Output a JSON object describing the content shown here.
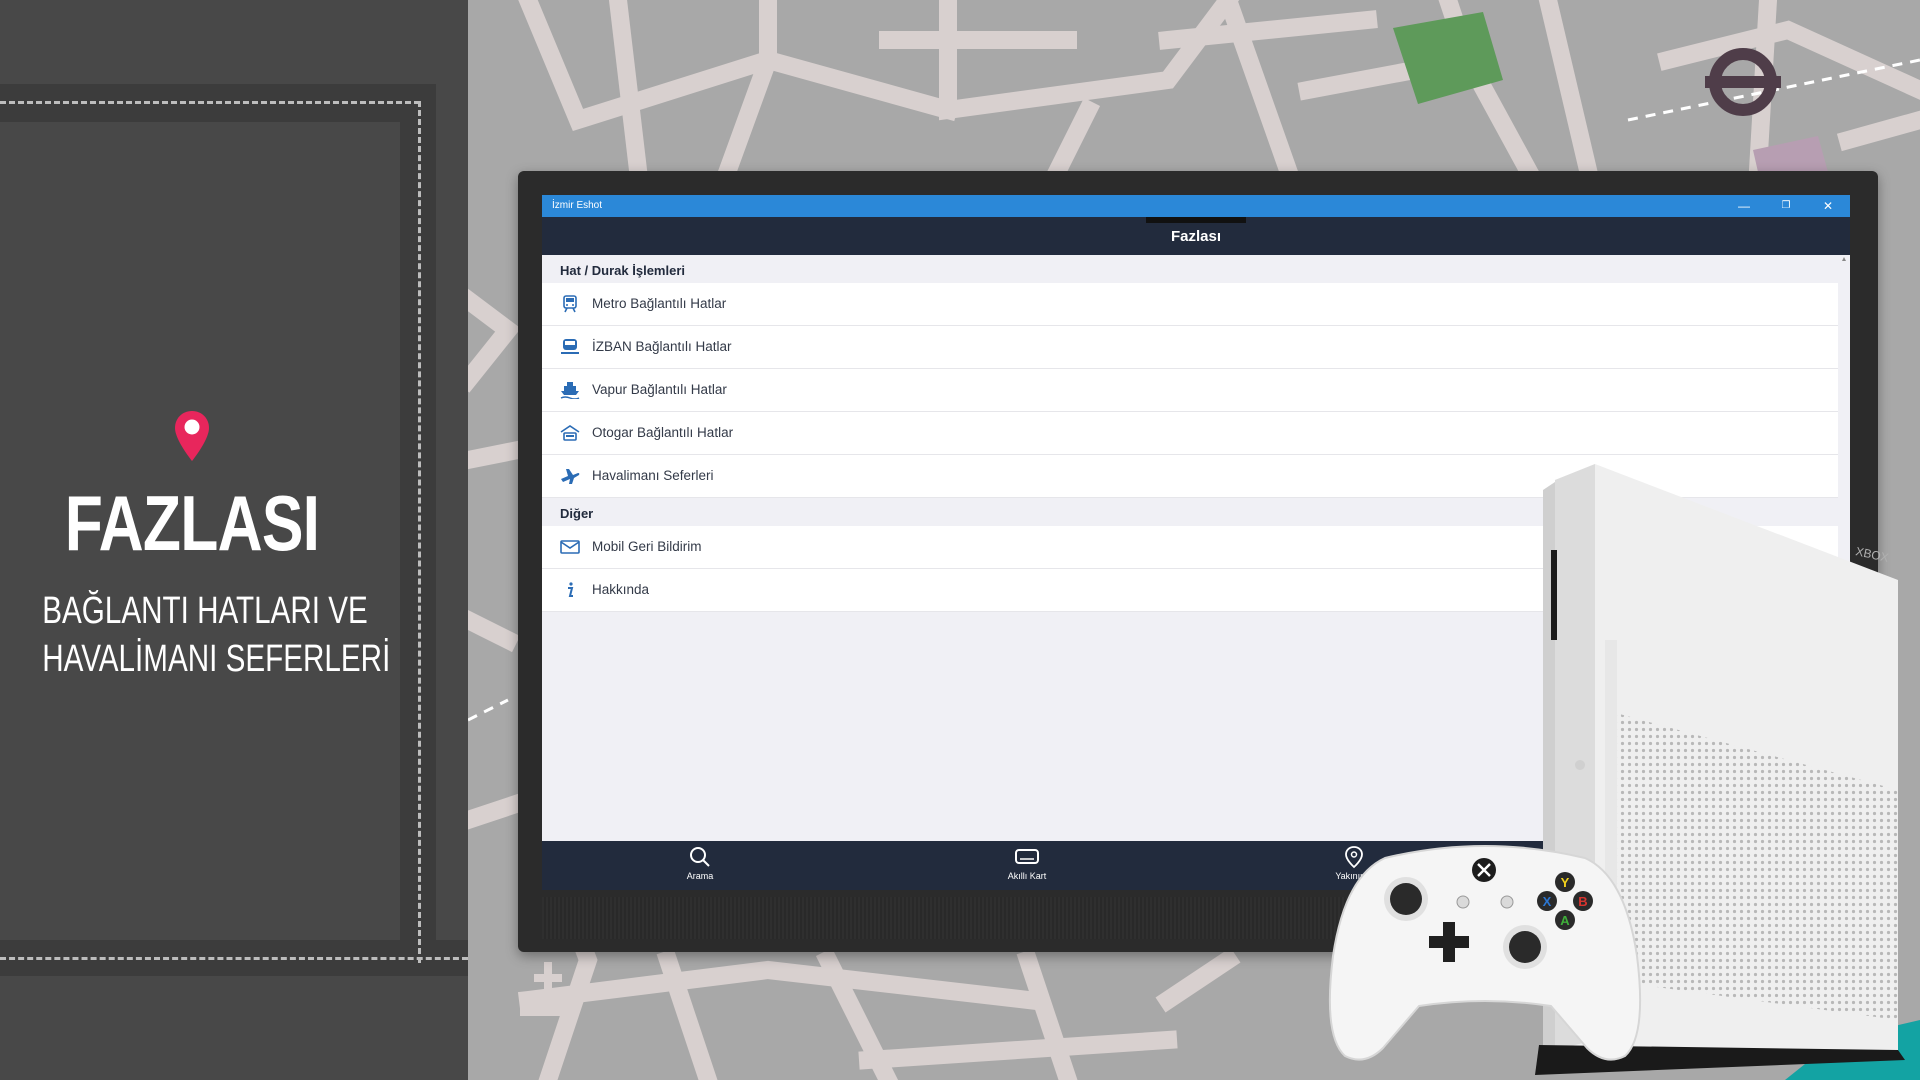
{
  "promo": {
    "title": "FAZLASI",
    "subtitle_line1": "BAĞLANTI HATLARI VE",
    "subtitle_line2": "HAVALİMANI SEFERLERİ",
    "pin_color": "#e8265c"
  },
  "app": {
    "window_title": "İzmir Eshot",
    "header_title": "Fazlası",
    "accent_color": "#2b88d8",
    "header_color": "#222b3d",
    "window_controls": [
      "—",
      "❐",
      "✕"
    ]
  },
  "sections": [
    {
      "title": "Hat / Durak İşlemleri",
      "items": [
        {
          "label": "Metro Bağlantılı Hatlar",
          "icon": "metro-icon"
        },
        {
          "label": "İZBAN Bağlantılı Hatlar",
          "icon": "train-icon"
        },
        {
          "label": "Vapur Bağlantılı Hatlar",
          "icon": "ferry-icon"
        },
        {
          "label": "Otogar Bağlantılı Hatlar",
          "icon": "bus-station-icon"
        },
        {
          "label": "Havalimanı Seferleri",
          "icon": "airplane-icon"
        }
      ]
    },
    {
      "title": "Diğer",
      "items": [
        {
          "label": "Mobil Geri Bildirim",
          "icon": "mail-icon"
        },
        {
          "label": "Hakkında",
          "icon": "info-icon"
        }
      ]
    }
  ],
  "bottom_nav": [
    {
      "label": "Arama",
      "icon": "search-icon"
    },
    {
      "label": "Akıllı Kart",
      "icon": "card-icon"
    },
    {
      "label": "Yakınımd",
      "icon": "location-icon"
    }
  ],
  "controller": {
    "buttons": [
      "Y",
      "X",
      "B",
      "A"
    ]
  }
}
